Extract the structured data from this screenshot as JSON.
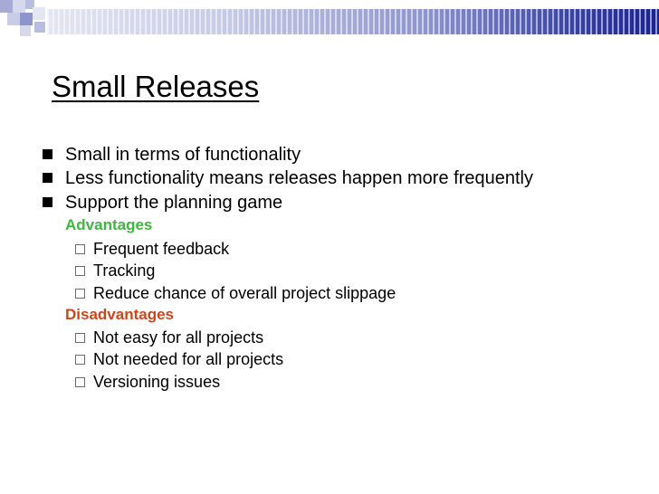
{
  "slide": {
    "title": "Small Releases",
    "colors": {
      "advantages": "#3cb83c",
      "disadvantages": "#d0441a",
      "band_dark": "#1a2190",
      "band_light": "#e4e6f2"
    },
    "bullets": [
      "Small in terms of functionality",
      "Less functionality means releases happen more frequently",
      "Support the planning game"
    ],
    "advantages": {
      "heading": "Advantages",
      "items": [
        "Frequent feedback",
        "Tracking",
        "Reduce chance of overall project slippage"
      ]
    },
    "disadvantages": {
      "heading": "Disadvantages",
      "items": [
        "Not easy for all projects",
        "Not needed for all projects",
        "Versioning issues"
      ]
    }
  }
}
